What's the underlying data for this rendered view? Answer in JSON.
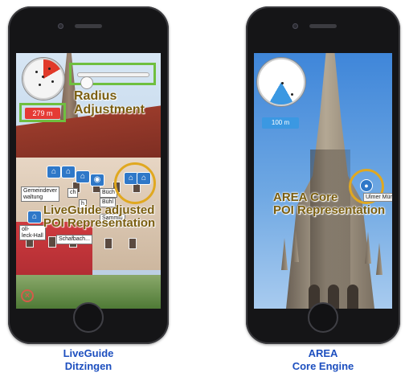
{
  "left_phone": {
    "distance": "279 m",
    "annotations": {
      "radius_line1": "Radius",
      "radius_line2": "Adjustment",
      "poi_line1": "LiveGuide adjusted",
      "poi_line2": "POI Representation"
    },
    "poi_labels": {
      "gemeinde_1": "Gemeindever",
      "gemeinde_2": "waltung",
      "ch": "ch",
      "buch": "Büch",
      "h": "h",
      "buhl": "Bühl",
      "sammlung": "Sammlu",
      "oll": "oll-",
      "leck": "leck-Hall",
      "schaf": "Schafbach..."
    },
    "icons": [
      "radar-icon",
      "building-icon",
      "camera-icon",
      "close-icon"
    ]
  },
  "right_phone": {
    "distance": "100 m",
    "annotations": {
      "line1": "AREA Core",
      "line2": "POI Representation"
    },
    "poi_label": "Ulmer Münster"
  },
  "captions": {
    "left_line1": "LiveGuide",
    "left_line2": "Ditzingen",
    "right_line1": "AREA",
    "right_line2": "Core Engine"
  },
  "colors": {
    "annotation_green": "#6fbf3f",
    "annotation_gold": "#e0a820",
    "caption_blue": "#1d4fbf",
    "radar_red": "#e13a2a",
    "radar_blue": "#3b98e2"
  }
}
